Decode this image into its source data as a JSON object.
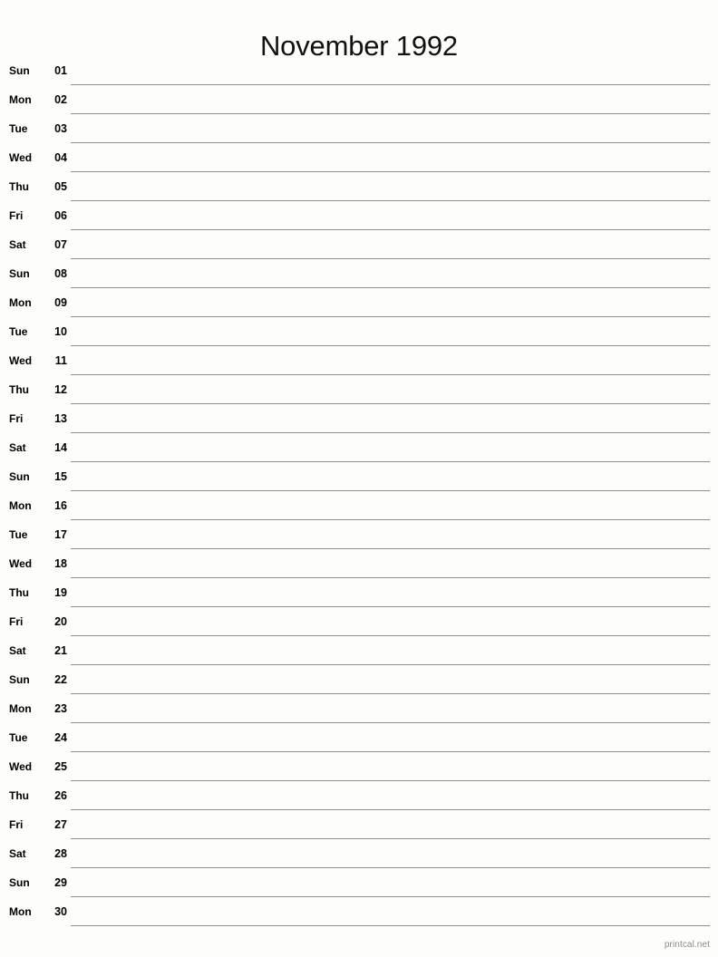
{
  "page": {
    "title": "November 1992",
    "month_name": "November",
    "year": "1992",
    "background_color": "#fdfdfa",
    "rule_color": "#8c8f8c",
    "text_color": "#000000"
  },
  "footer": {
    "credit": "printcal.net",
    "credit_color": "#8a8a8a"
  },
  "calendar": {
    "days": [
      {
        "weekday": "Sun",
        "number": "01"
      },
      {
        "weekday": "Mon",
        "number": "02"
      },
      {
        "weekday": "Tue",
        "number": "03"
      },
      {
        "weekday": "Wed",
        "number": "04"
      },
      {
        "weekday": "Thu",
        "number": "05"
      },
      {
        "weekday": "Fri",
        "number": "06"
      },
      {
        "weekday": "Sat",
        "number": "07"
      },
      {
        "weekday": "Sun",
        "number": "08"
      },
      {
        "weekday": "Mon",
        "number": "09"
      },
      {
        "weekday": "Tue",
        "number": "10"
      },
      {
        "weekday": "Wed",
        "number": "11"
      },
      {
        "weekday": "Thu",
        "number": "12"
      },
      {
        "weekday": "Fri",
        "number": "13"
      },
      {
        "weekday": "Sat",
        "number": "14"
      },
      {
        "weekday": "Sun",
        "number": "15"
      },
      {
        "weekday": "Mon",
        "number": "16"
      },
      {
        "weekday": "Tue",
        "number": "17"
      },
      {
        "weekday": "Wed",
        "number": "18"
      },
      {
        "weekday": "Thu",
        "number": "19"
      },
      {
        "weekday": "Fri",
        "number": "20"
      },
      {
        "weekday": "Sat",
        "number": "21"
      },
      {
        "weekday": "Sun",
        "number": "22"
      },
      {
        "weekday": "Mon",
        "number": "23"
      },
      {
        "weekday": "Tue",
        "number": "24"
      },
      {
        "weekday": "Wed",
        "number": "25"
      },
      {
        "weekday": "Thu",
        "number": "26"
      },
      {
        "weekday": "Fri",
        "number": "27"
      },
      {
        "weekday": "Sat",
        "number": "28"
      },
      {
        "weekday": "Sun",
        "number": "29"
      },
      {
        "weekday": "Mon",
        "number": "30"
      }
    ]
  }
}
